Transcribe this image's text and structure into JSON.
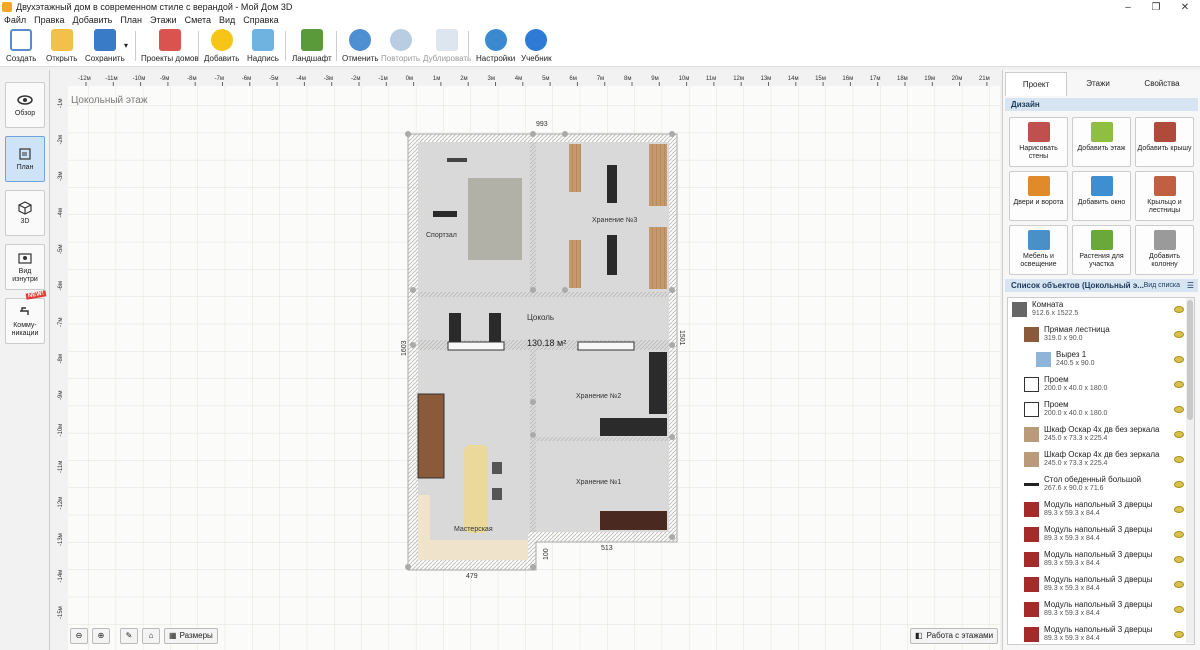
{
  "window": {
    "title": "Двухэтажный дом в современном стиле с верандой - Мой Дом 3D"
  },
  "menu": [
    "Файл",
    "Правка",
    "Добавить",
    "План",
    "Этажи",
    "Смета",
    "Вид",
    "Справка"
  ],
  "toolbar": {
    "create": "Создать",
    "open": "Открыть",
    "save": "Сохранить",
    "projects": "Проекты домов",
    "add": "Добавить",
    "label": "Надпись",
    "landscape": "Ландшафт",
    "undo": "Отменить",
    "redo": "Повторить",
    "duplicate": "Дублировать",
    "settings": "Настройки",
    "tutorial": "Учебник"
  },
  "left_nav": {
    "overview": "Обзор",
    "plan": "План",
    "view3d": "3D",
    "inside": "Вид изнутри",
    "comms": "Комму-никации",
    "new_badge": "NEW!"
  },
  "canvas": {
    "floor_label": "Цокольный этаж",
    "ruler_top": [
      "-12м",
      "-11м",
      "-10м",
      "-9м",
      "-8м",
      "-7м",
      "-6м",
      "-5м",
      "-4м",
      "-3м",
      "-2м",
      "-1м",
      "0м",
      "1м",
      "2м",
      "3м",
      "4м",
      "5м",
      "6м",
      "7м",
      "8м",
      "9м",
      "10м",
      "11м",
      "12м",
      "13м",
      "14м",
      "15м",
      "16м",
      "17м",
      "18м",
      "19м",
      "20м",
      "21м",
      "22м"
    ],
    "ruler_left": [
      "-1м",
      "-2м",
      "-3м",
      "-4м",
      "-5м",
      "-6м",
      "-7м",
      "-8м",
      "-9м",
      "-10м",
      "-11м",
      "-12м",
      "-13м",
      "-14м",
      "-15м"
    ],
    "rooms": {
      "gym": "Спортзал",
      "storage3": "Хранение №3",
      "plinth": "Цоколь",
      "area": "130.18 м²",
      "storage2": "Хранение №2",
      "storage1": "Хранение №1",
      "workshop": "Мастерская"
    },
    "dims": {
      "top": "993",
      "left": "1603",
      "right": "1501",
      "bottom_left": "479",
      "bottom_right": "513",
      "step": "100"
    },
    "buttons": {
      "sizes": "Размеры",
      "floors_work": "Работа с этажами"
    }
  },
  "right_panel": {
    "tabs": [
      "Проект",
      "Этажи",
      "Свойства"
    ],
    "design_header": "Дизайн",
    "design_buttons": [
      {
        "label": "Нарисовать стены",
        "color": "#c0504d"
      },
      {
        "label": "Добавить этаж",
        "color": "#8fbf40"
      },
      {
        "label": "Добавить крышу",
        "color": "#b04a3a"
      },
      {
        "label": "Двери и ворота",
        "color": "#e08a2a"
      },
      {
        "label": "Добавить окно",
        "color": "#3d8fd1"
      },
      {
        "label": "Крыльцо и лестницы",
        "color": "#c06040"
      },
      {
        "label": "Мебель и освещение",
        "color": "#4a90c8"
      },
      {
        "label": "Растения для участка",
        "color": "#6aa83a"
      },
      {
        "label": "Добавить колонну",
        "color": "#9a9a9a"
      }
    ],
    "objects_header": "Список объектов (Цокольный э...",
    "list_view": "Вид списка",
    "objects": [
      {
        "name": "Комната",
        "size": "912.6 x 1522.5",
        "icon": "room-icon",
        "indent": 0
      },
      {
        "name": "Прямая лестница",
        "size": "319.0 x 90.0",
        "icon": "stairs-icon",
        "indent": 1
      },
      {
        "name": "Вырез 1",
        "size": "240.5 x 90.0",
        "icon": "cutout-icon",
        "indent": 2
      },
      {
        "name": "Проем",
        "size": "200.0 x 40.0 x 180.0",
        "icon": "opening-icon",
        "indent": 1
      },
      {
        "name": "Проем",
        "size": "200.0 x 40.0 x 180.0",
        "icon": "opening-icon",
        "indent": 1
      },
      {
        "name": "Шкаф Оскар 4х дв без зеркала",
        "size": "245.0 x 73.3 x 225.4",
        "icon": "wardrobe-icon",
        "indent": 1
      },
      {
        "name": "Шкаф Оскар 4х дв без зеркала",
        "size": "245.0 x 73.3 x 225.4",
        "icon": "wardrobe-icon",
        "indent": 1
      },
      {
        "name": "Стол обеденный большой",
        "size": "267.6 x 90.0 x 71.6",
        "icon": "table-icon",
        "indent": 1
      },
      {
        "name": "Модуль напольный 3 дверцы",
        "size": "89.3 x 59.3 x 84.4",
        "icon": "cabinet-icon",
        "indent": 1
      },
      {
        "name": "Модуль напольный 3 дверцы",
        "size": "89.3 x 59.3 x 84.4",
        "icon": "cabinet-icon",
        "indent": 1
      },
      {
        "name": "Модуль напольный 3 дверцы",
        "size": "89.3 x 59.3 x 84.4",
        "icon": "cabinet-icon",
        "indent": 1
      },
      {
        "name": "Модуль напольный 3 дверцы",
        "size": "89.3 x 59.3 x 84.4",
        "icon": "cabinet-icon",
        "indent": 1
      },
      {
        "name": "Модуль напольный 3 дверцы",
        "size": "89.3 x 59.3 x 84.4",
        "icon": "cabinet-icon",
        "indent": 1
      },
      {
        "name": "Модуль напольный 3 дверцы",
        "size": "89.3 x 59.3 x 84.4",
        "icon": "cabinet-icon",
        "indent": 1
      }
    ]
  }
}
